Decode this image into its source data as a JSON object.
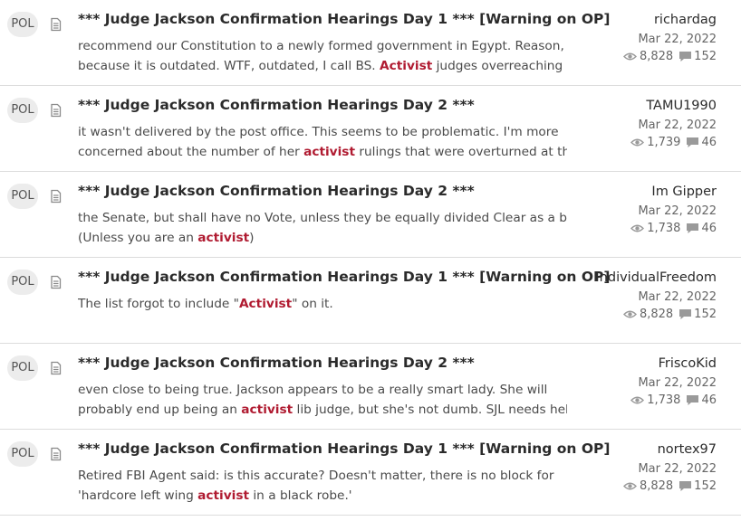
{
  "results": [
    {
      "forum": "POL",
      "title": "*** Judge Jackson Confirmation Hearings Day 1 *** [Warning on OP]",
      "snippet_line1": [
        {
          "text": "recommend our Constitution to a newly formed government in Egypt. Reason,",
          "hl": false
        }
      ],
      "snippet_line2": [
        {
          "text": "because it is outdated. WTF, outdated, I call BS. ",
          "hl": false
        },
        {
          "text": "Activist",
          "hl": true
        },
        {
          "text": " judges overreaching has",
          "hl": false
        }
      ],
      "author": "richardag",
      "date": "Mar 22, 2022",
      "views": "8,828",
      "replies": "152"
    },
    {
      "forum": "POL",
      "title": "*** Judge Jackson Confirmation Hearings Day 2 ***",
      "snippet_line1": [
        {
          "text": "it wasn't delivered by the post office. This seems to be problematic. I'm more",
          "hl": false
        }
      ],
      "snippet_line2": [
        {
          "text": "concerned about the number of her ",
          "hl": false
        },
        {
          "text": "activist",
          "hl": true
        },
        {
          "text": " rulings that were overturned at the",
          "hl": false
        }
      ],
      "author": "TAMU1990",
      "date": "Mar 22, 2022",
      "views": "1,739",
      "replies": "46"
    },
    {
      "forum": "POL",
      "title": "*** Judge Jackson Confirmation Hearings Day 2 ***",
      "snippet_line1": [
        {
          "text": "the Senate, but shall have no Vote, unless they be equally divided Clear as a bell.",
          "hl": false
        }
      ],
      "snippet_line2": [
        {
          "text": "(Unless you are an ",
          "hl": false
        },
        {
          "text": "activist",
          "hl": true
        },
        {
          "text": ")",
          "hl": false
        }
      ],
      "author": "Im Gipper",
      "date": "Mar 22, 2022",
      "views": "1,738",
      "replies": "46"
    },
    {
      "forum": "POL",
      "title": "*** Judge Jackson Confirmation Hearings Day 1 *** [Warning on OP]",
      "snippet_line1": [
        {
          "text": "The list forgot to include \"",
          "hl": false
        },
        {
          "text": "Activist",
          "hl": true
        },
        {
          "text": "\" on it.",
          "hl": false
        }
      ],
      "snippet_line2": [],
      "author": "IndividualFreedom",
      "date": "Mar 22, 2022",
      "views": "8,828",
      "replies": "152"
    },
    {
      "forum": "POL",
      "title": "*** Judge Jackson Confirmation Hearings Day 2 ***",
      "snippet_line1": [
        {
          "text": "even close to being true. Jackson appears to be a really smart lady. She will",
          "hl": false
        }
      ],
      "snippet_line2": [
        {
          "text": "probably end up being an ",
          "hl": false
        },
        {
          "text": "activist",
          "hl": true
        },
        {
          "text": " lib judge, but she's not dumb. SJL needs help",
          "hl": false
        }
      ],
      "author": "FriscoKid",
      "date": "Mar 22, 2022",
      "views": "1,738",
      "replies": "46"
    },
    {
      "forum": "POL",
      "title": "*** Judge Jackson Confirmation Hearings Day 1 *** [Warning on OP]",
      "snippet_line1": [
        {
          "text": "Retired FBI Agent said: is this accurate? Doesn't matter, there is no block for",
          "hl": false
        }
      ],
      "snippet_line2": [
        {
          "text": "'hardcore left wing ",
          "hl": false
        },
        {
          "text": "activist",
          "hl": true
        },
        {
          "text": " in a black robe.'",
          "hl": false
        }
      ],
      "author": "nortex97",
      "date": "Mar 22, 2022",
      "views": "8,828",
      "replies": "152"
    }
  ],
  "icons": {
    "doc": "document-icon",
    "views": "eye-icon",
    "replies": "speech-bubble-icon"
  },
  "colors": {
    "highlight": "#b01b31",
    "badge_bg": "#ececec",
    "icon": "#9a9a9a"
  }
}
